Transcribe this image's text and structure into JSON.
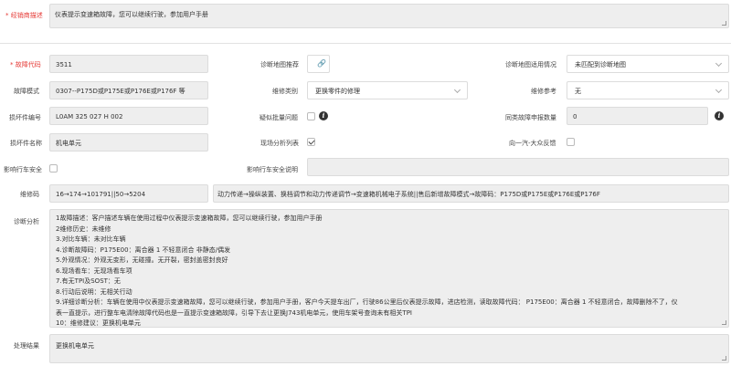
{
  "dealer_desc": {
    "label": "经销商描述",
    "required_mark": "*",
    "value": "仪表提示变速箱故障，您可以继续行驶，参加用户手册"
  },
  "fault_code": {
    "label": "故障代码",
    "required_mark": "*",
    "value": "3511"
  },
  "diag_map_recommend": {
    "label": "诊断地图推荐",
    "icon": "link-icon",
    "icon_glyph": "🔗"
  },
  "diag_map_status": {
    "label": "诊断地图适用情况",
    "value": "未匹配到诊断地图"
  },
  "fault_mode": {
    "label": "故障模式",
    "value": "0307--P175D或P175E或P176E或P176F 等"
  },
  "repair_type": {
    "label": "维修类别",
    "value": "更换零件的修理"
  },
  "repair_ref": {
    "label": "维修参考",
    "value": "无"
  },
  "damaged_part_no": {
    "label": "损坏件编号",
    "value": "L0AM 325 027 H 002"
  },
  "suspected_batch": {
    "label": "疑似批量问题",
    "checked": false,
    "info_glyph": "i"
  },
  "same_fault_count": {
    "label": "同类故障申报数量",
    "value": "0"
  },
  "damaged_part_name": {
    "label": "损坏件名称",
    "value": "机电单元"
  },
  "onsite_analysis": {
    "label": "现场分析列表",
    "checked": true
  },
  "faw_vw_feedback": {
    "label": "向一汽-大众反馈",
    "checked": false
  },
  "safety_impact": {
    "label": "影响行车安全",
    "checked": false
  },
  "safety_desc": {
    "label": "影响行车安全说明",
    "value": ""
  },
  "repair_code": {
    "label": "维修码",
    "value": "16→174→101791||50→5204",
    "path": "动力传递→操纵装置、换档调节和动力传递调节→变速箱机械电子系统||售后新增故障模式→故障码：P175D或P175E或P176E或P176F"
  },
  "diagnosis": {
    "label": "诊断分析",
    "lines": [
      "1故障描述：客户描述车辆在使用过程中仪表提示变速箱故障，您可以继续行驶，参加用户手册",
      "2维修历史：未维修",
      "3.对比车辆：未对比车辆",
      "4.诊断故障码：P175E00：离合器 1 不轻意闭合 非静态/偶发",
      "5.外观情况：外观无变形，无碰撞。无开裂，密封盖密封良好",
      "6.现场看车：无现场看车项",
      "7.有无TPI及SOST：无",
      "8.行动后说明：无相关行动",
      "9.详细诊断分析：车辆在使用中仪表提示变速箱故障，您可以继续行驶，参加用户手册，客户今天提车出厂，行驶86公里后仪表提示故障，进店检测，读取故障代码：  P175E00：离合器 1 不轻意闭合，故障删除不了，仪",
      "表一直提示，进行整车电清除故障代码也是一直提示变速箱故障，引导下去让更换J743机电单元，使用车架号查询未有相关TPI",
      "10：维修建议：更换机电单元"
    ]
  },
  "result": {
    "label": "处理结果",
    "value": "更换机电单元"
  },
  "colors": {
    "required": "#e53935",
    "field_bg": "#eeeeee",
    "border": "#dcdcdc"
  }
}
